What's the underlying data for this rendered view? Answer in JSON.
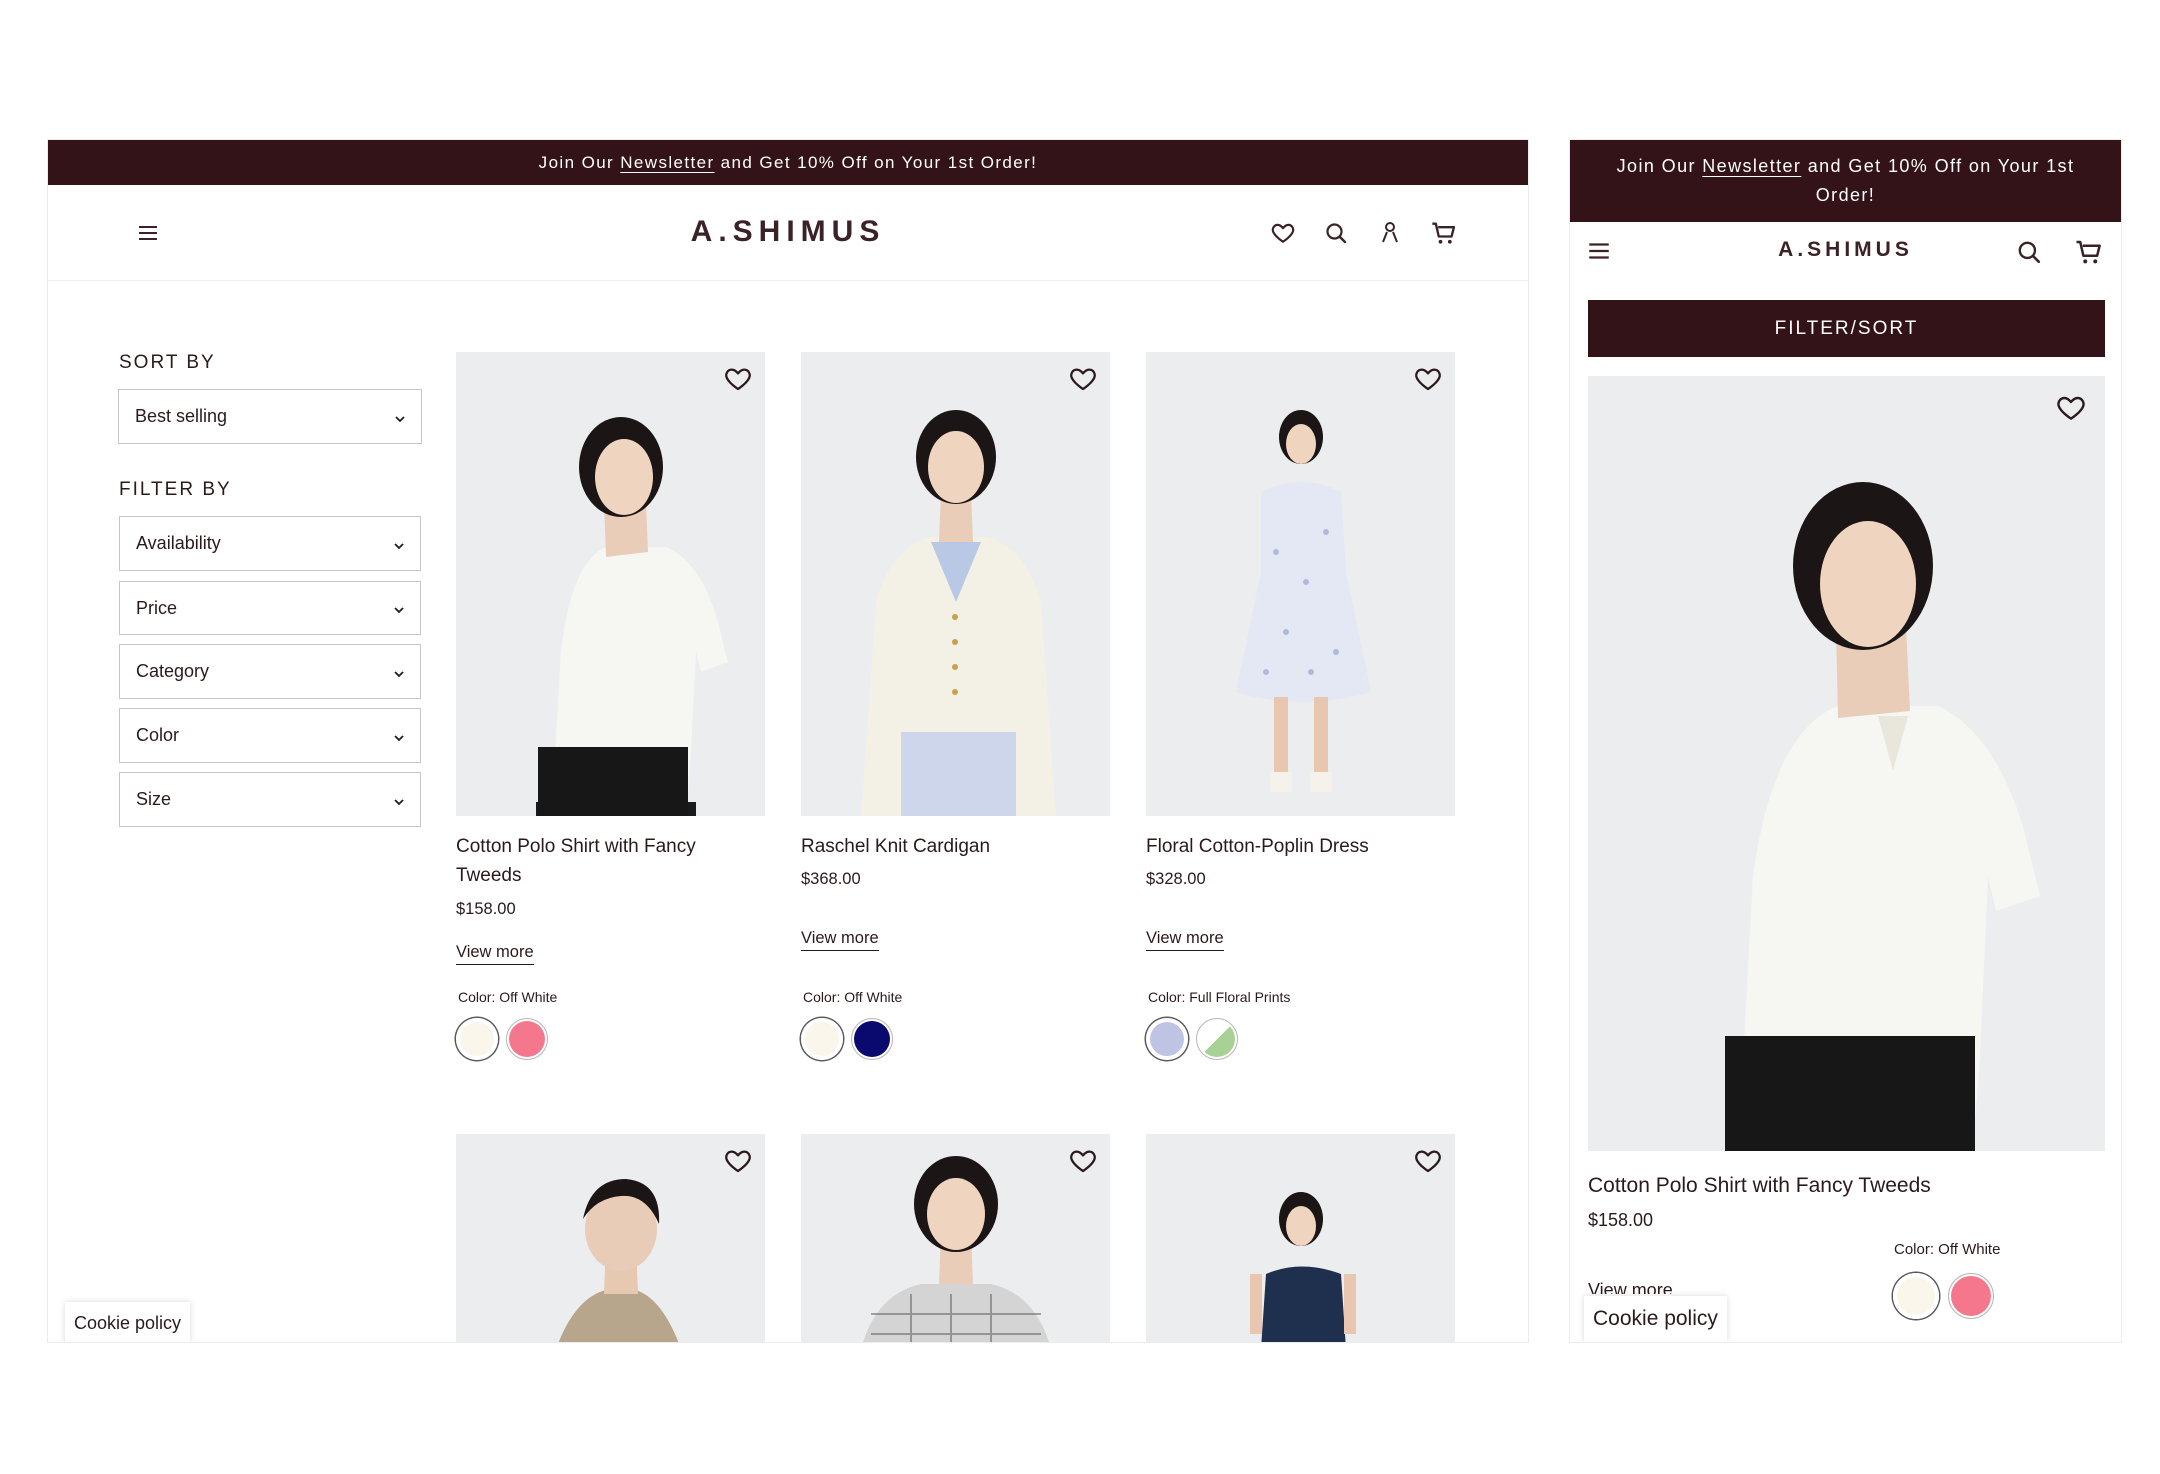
{
  "banner": {
    "prefix": "Join Our ",
    "link": "Newsletter",
    "suffix": " and Get 10% Off on Your 1st Order!"
  },
  "brand": {
    "logo": "A.SHIMUS"
  },
  "sidebar": {
    "sort_label": "SORT BY",
    "sort_value": "Best selling",
    "filter_label": "FILTER BY",
    "filters": [
      "Availability",
      "Price",
      "Category",
      "Color",
      "Size"
    ]
  },
  "products": [
    {
      "title_line1": "Cotton Polo Shirt with Fancy",
      "title_line2": "Tweeds",
      "title_full": "Cotton Polo Shirt with Fancy Tweeds",
      "price": "$158.00",
      "view_more": "View more",
      "color_label": "Color: Off White",
      "swatches": [
        "#fbf6ec",
        "#f4778e"
      ]
    },
    {
      "title_line1": "Raschel Knit Cardigan",
      "price": "$368.00",
      "view_more": "View more",
      "color_label": "Color: Off White",
      "swatches": [
        "#fbf6ec",
        "#0a0a6e"
      ]
    },
    {
      "title_line1": "Floral Cotton-Poplin Dress",
      "price": "$328.00",
      "view_more": "View more",
      "color_label": "Color: Full Floral Prints",
      "swatches": [
        "#bfc3e4",
        "#a8d195"
      ]
    }
  ],
  "mobile": {
    "filter_sort": "FILTER/SORT",
    "view_more_partial": "View more"
  },
  "cookie": {
    "label": "Cookie policy"
  },
  "colors": {
    "accent": "#331317",
    "photo_bg": "#ecedee"
  }
}
